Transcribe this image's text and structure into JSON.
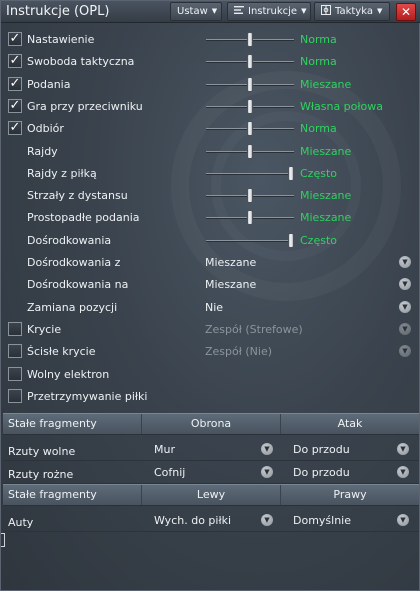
{
  "window": {
    "title": "Instrukcje (OPL)",
    "menu": {
      "ustaw": "Ustaw",
      "instrukcje": "Instrukcje",
      "taktyka": "Taktyka",
      "close": "✕"
    }
  },
  "slider_rows": [
    {
      "label": "Nastawienie",
      "checked": true,
      "value": "Norma",
      "level": 0.5
    },
    {
      "label": "Swoboda taktyczna",
      "checked": true,
      "value": "Norma",
      "level": 0.5
    },
    {
      "label": "Podania",
      "checked": true,
      "value": "Mieszane",
      "level": 0.5
    },
    {
      "label": "Gra przy przeciwniku",
      "checked": true,
      "value": "Własna połowa",
      "level": 0.5
    },
    {
      "label": "Odbiór",
      "checked": true,
      "value": "Norma",
      "level": 0.5
    },
    {
      "label": "Rajdy",
      "checked": false,
      "value": "Mieszane",
      "level": 0.5
    },
    {
      "label": "Rajdy z piłką",
      "checked": false,
      "value": "Często",
      "level": 1.0
    },
    {
      "label": "Strzały z dystansu",
      "checked": false,
      "value": "Mieszane",
      "level": 0.5
    },
    {
      "label": "Prostopadłe podania",
      "checked": false,
      "value": "Mieszane",
      "level": 0.5
    },
    {
      "label": "Dośrodkowania",
      "checked": false,
      "value": "Często",
      "level": 1.0
    }
  ],
  "dropdown_rows": [
    {
      "label": "Dośrodkowania z",
      "value": "Mieszane",
      "disabled": false
    },
    {
      "label": "Dośrodkowania na",
      "value": "Mieszane",
      "disabled": false
    },
    {
      "label": "Zamiana pozycji",
      "value": "Nie",
      "disabled": false
    }
  ],
  "check_rows": [
    {
      "label": "Krycie",
      "checked": false,
      "value": "Zespół (Strefowe)",
      "disabled": true
    },
    {
      "label": "Ścisłe krycie",
      "checked": false,
      "value": "Zespół (Nie)",
      "disabled": true
    },
    {
      "label": "Wolny elektron",
      "checked": false,
      "value": null
    },
    {
      "label": "Przetrzymywanie piłki",
      "checked": false,
      "value": null
    }
  ],
  "set_pieces_1": {
    "headers": [
      "Stałe fragmenty",
      "Obrona",
      "Atak"
    ],
    "rows": [
      {
        "label": "Rzuty wolne",
        "a": "Mur",
        "b": "Do przodu"
      },
      {
        "label": "Rzuty rożne",
        "a": "Cofnij",
        "b": "Do przodu"
      }
    ]
  },
  "set_pieces_2": {
    "headers": [
      "Stałe fragmenty",
      "Lewy",
      "Prawy"
    ],
    "rows": [
      {
        "label": "Auty",
        "a": "Wych. do piłki",
        "b": "Domyślnie"
      }
    ]
  },
  "colors": {
    "value_green": "#2fd25f",
    "close_red": "#c62828",
    "panel_bg": "#3a434d"
  },
  "icons": {
    "check": "✓",
    "dropdown": "▼"
  }
}
